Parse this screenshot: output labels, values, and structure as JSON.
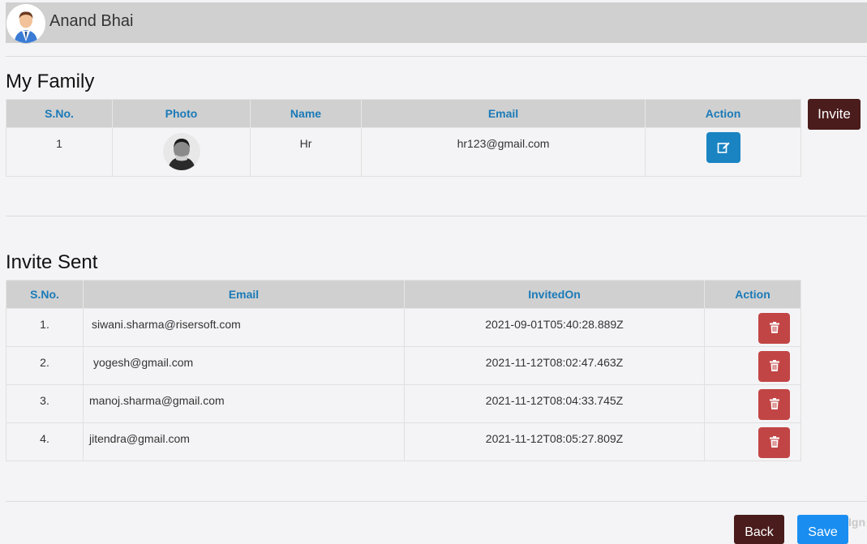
{
  "header": {
    "user_name": "Anand Bhai",
    "avatar_icon": "user-avatar-icon"
  },
  "family": {
    "title": "My Family",
    "columns": [
      "S.No.",
      "Photo",
      "Name",
      "Email",
      "Action"
    ],
    "rows": [
      {
        "sno": "1",
        "name": "Hr",
        "email": "hr123@gmail.com",
        "photo_icon": "profile-photo",
        "action_icon": "edit-icon"
      }
    ],
    "invite_label": "Invite"
  },
  "invites": {
    "title": "Invite Sent",
    "columns": [
      "S.No.",
      "Email",
      "InvitedOn",
      "Action"
    ],
    "rows": [
      {
        "sno": "1.",
        "email": "siwani.sharma@risersoft.com",
        "invited_on": "2021-09-01T05:40:28.889Z"
      },
      {
        "sno": "2.",
        "email": "yogesh@gmail.com",
        "invited_on": "2021-11-12T08:02:47.463Z"
      },
      {
        "sno": "3.",
        "email": "manoj.sharma@gmail.com",
        "invited_on": "2021-11-12T08:04:33.745Z"
      },
      {
        "sno": "4.",
        "email": "jitendra@gmail.com",
        "invited_on": "2021-11-12T08:05:27.809Z"
      }
    ],
    "action_icon": "trash-icon"
  },
  "footer": {
    "back_label": "Back",
    "save_label": "Save",
    "trailing_text": "Ign"
  },
  "colors": {
    "header_bg": "#d0d0d0",
    "link_blue": "#1a7ab8",
    "edit_btn": "#1a84c3",
    "delete_btn": "#c24545",
    "dark_btn": "#4a1c1c",
    "save_btn": "#1a8ef0"
  }
}
